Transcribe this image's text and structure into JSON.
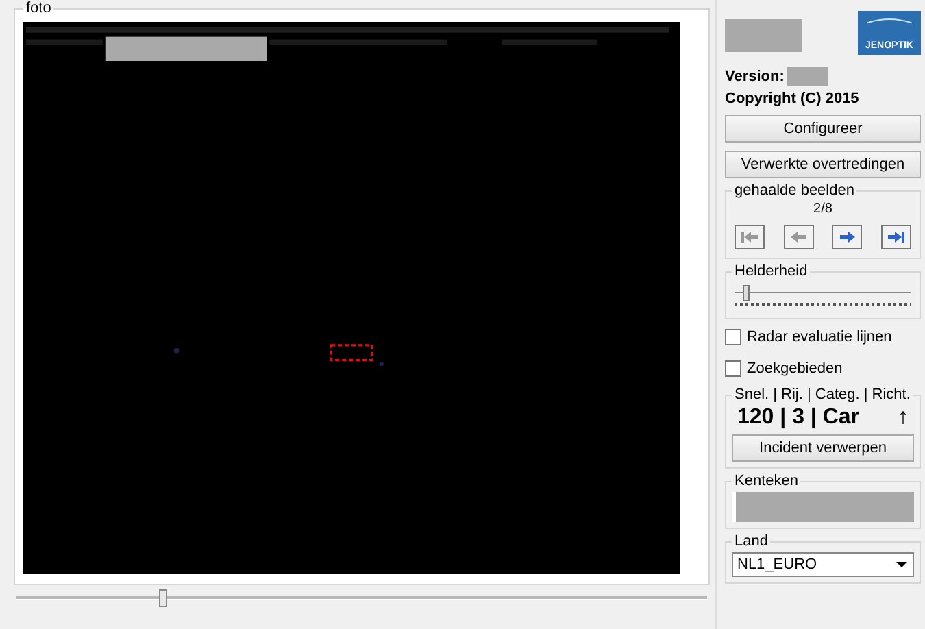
{
  "photo_panel": {
    "title": "foto",
    "slider": {
      "level": 0.21
    }
  },
  "side": {
    "logo": "JENOPTIK",
    "version_label": "Version:",
    "copyright": "Copyright (C) 2015",
    "buttons": [
      {
        "label": "Configureer"
      },
      {
        "label": "Verwerkte overtredingen"
      }
    ],
    "images": {
      "title": "gehaalde beelden",
      "counter": "2/8"
    },
    "brightness": {
      "title": "Helderheid",
      "level": 0.05
    },
    "options": [
      {
        "label": "Radar evaluatie lijnen",
        "checked": false
      },
      {
        "label": "Zoekgebieden",
        "checked": false
      }
    ],
    "measure": {
      "title": "Snel. | Rij. | Categ. | Richt.",
      "value": "120 | 3 | Car",
      "arrow": "↑",
      "button": "Incident verwerpen"
    },
    "plate": {
      "title": "Kenteken"
    },
    "country": {
      "title": "Land",
      "value": "NL1_EURO"
    }
  }
}
